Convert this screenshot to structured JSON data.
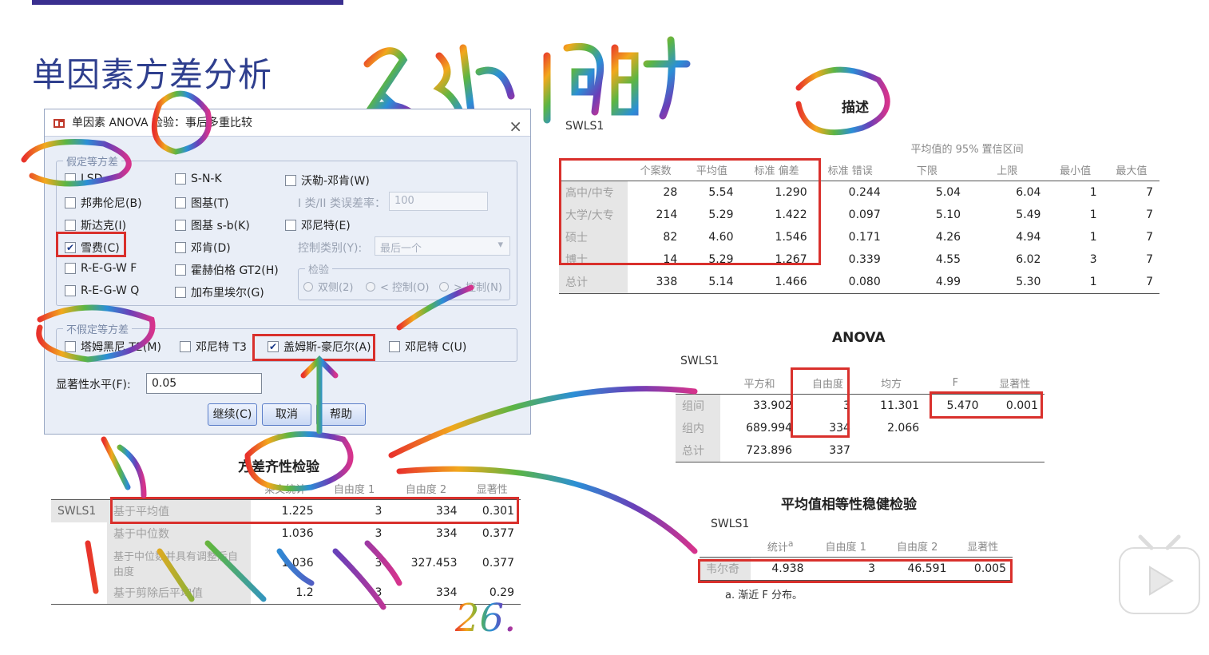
{
  "slide": {
    "title": "单因素方差分析"
  },
  "dialog": {
    "title": "单因素 ANOVA 检验：事后多重比较",
    "equal_var": {
      "label": "假定等方差",
      "options": [
        "LSD",
        "邦弗伦尼(B)",
        "斯达克(I)",
        "雪费(C)",
        "R-E-G-W F",
        "R-E-G-W Q",
        "S-N-K",
        "图基(T)",
        "图基 s-b(K)",
        "邓肯(D)",
        "霍赫伯格 GT2(H)",
        "加布里埃尔(G)",
        "沃勒-邓肯(W)",
        "邓尼特(E)"
      ],
      "checked": "雪费(C)",
      "type_ratio_label": "I 类/II 类误差率：",
      "type_ratio_value": "100",
      "control_label": "控制类别(Y):",
      "control_value": "最后一个",
      "test_label": "检验",
      "test_options": [
        "双侧(2)",
        "< 控制(O)",
        "> 控制(N)"
      ]
    },
    "unequal_var": {
      "label": "不假定等方差",
      "options": [
        "塔姆黑尼 T2(M)",
        "邓尼特 T3",
        "盖姆斯-豪厄尔(A)",
        "邓尼特 C(U)"
      ],
      "checked": "盖姆斯-豪厄尔(A)"
    },
    "sig_label": "显著性水平(F):",
    "sig_value": "0.05",
    "buttons": [
      "继续(C)",
      "取消",
      "帮助"
    ]
  },
  "descriptives": {
    "title": "描述",
    "var": "SWLS1",
    "ci_header": "平均值的 95% 置信区间",
    "columns": [
      "个案数",
      "平均值",
      "标准 偏差",
      "标准 错误",
      "下限",
      "上限",
      "最小值",
      "最大值"
    ],
    "rows": [
      {
        "label": "高中/中专",
        "values": [
          "28",
          "5.54",
          "1.290",
          "0.244",
          "5.04",
          "6.04",
          "1",
          "7"
        ]
      },
      {
        "label": "大学/大专",
        "values": [
          "214",
          "5.29",
          "1.422",
          "0.097",
          "5.10",
          "5.49",
          "1",
          "7"
        ]
      },
      {
        "label": "硕士",
        "values": [
          "82",
          "4.60",
          "1.546",
          "0.171",
          "4.26",
          "4.94",
          "1",
          "7"
        ]
      },
      {
        "label": "博士",
        "values": [
          "14",
          "5.29",
          "1.267",
          "0.339",
          "4.55",
          "6.02",
          "3",
          "7"
        ]
      },
      {
        "label": "总计",
        "values": [
          "338",
          "5.14",
          "1.466",
          "0.080",
          "4.99",
          "5.30",
          "1",
          "7"
        ]
      }
    ]
  },
  "anova": {
    "title": "ANOVA",
    "var": "SWLS1",
    "columns": [
      "平方和",
      "自由度",
      "均方",
      "F",
      "显著性"
    ],
    "rows": [
      {
        "label": "组间",
        "values": [
          "33.902",
          "3",
          "11.301",
          "5.470",
          "0.001"
        ]
      },
      {
        "label": "组内",
        "values": [
          "689.994",
          "334",
          "2.066",
          "",
          ""
        ]
      },
      {
        "label": "总计",
        "values": [
          "723.896",
          "337",
          "",
          "",
          ""
        ]
      }
    ]
  },
  "homogeneity": {
    "title": "方差齐性检验",
    "var": "SWLS1",
    "columns": [
      "莱文统计",
      "自由度 1",
      "自由度 2",
      "显著性"
    ],
    "rows": [
      {
        "label": "基于平均值",
        "values": [
          "1.225",
          "3",
          "334",
          "0.301"
        ]
      },
      {
        "label": "基于中位数",
        "values": [
          "1.036",
          "3",
          "334",
          "0.377"
        ]
      },
      {
        "label": "基于中位数并具有调整后自由度",
        "values": [
          "1.036",
          "3",
          "327.453",
          "0.377"
        ]
      },
      {
        "label": "基于剪除后平均值",
        "values": [
          "1.2",
          "3",
          "334",
          "0.29"
        ]
      }
    ]
  },
  "robust": {
    "title": "平均值相等性稳健检验",
    "var": "SWLS1",
    "columns": [
      "统计",
      "自由度 1",
      "自由度 2",
      "显著性"
    ],
    "stat_sup": "a",
    "rows": [
      {
        "label": "韦尔奇",
        "values": [
          "4.938",
          "3",
          "46.591",
          "0.005"
        ]
      }
    ],
    "footnote": "a. 渐近 F 分布。"
  },
  "annotations": {
    "heading": "多组，同时",
    "number": "26."
  },
  "colors": {
    "title": "#2f3f8e",
    "highlight": "#d9302c",
    "dialog_bg": "#e9eef7"
  }
}
